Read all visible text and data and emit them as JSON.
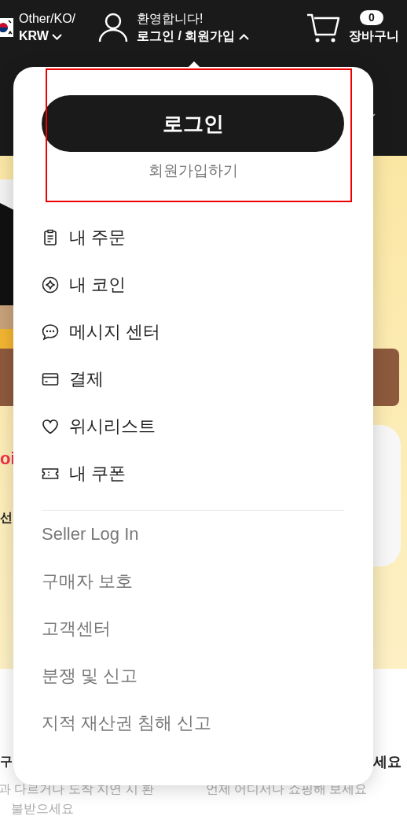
{
  "header": {
    "region": {
      "line1": "Other/KO/",
      "currency": "KRW"
    },
    "account": {
      "greeting": "환영합니다!",
      "label": "로그인 / 회원가입",
      "expanded": true
    },
    "cart": {
      "count": "0",
      "label": "장바구니"
    }
  },
  "account_menu": {
    "login_button": "로그인",
    "signup_link": "회원가입하기",
    "items": [
      {
        "label": "내 주문"
      },
      {
        "label": "내 코인"
      },
      {
        "label": "메시지 센터"
      },
      {
        "label": "결제"
      },
      {
        "label": "위시리스트"
      },
      {
        "label": "내 쿠폰"
      }
    ],
    "links": [
      "Seller Log In",
      "구매자 보호",
      "고객센터",
      "분쟁 및 신고",
      "지적 재산권 침해 신고"
    ]
  },
  "background": {
    "fragments": [
      {
        "text": "oi",
        "kind": "accent"
      },
      {
        "text": "선",
        "kind": "heading"
      },
      {
        "text": "구",
        "kind": "heading"
      },
      {
        "text": "세요",
        "kind": "heading"
      },
      {
        "text": "과 다르거나 도착 지연 시 환",
        "kind": "faded"
      },
      {
        "text": "불받으세요",
        "kind": "faded"
      },
      {
        "text": "언제 어디서나 쇼핑해 보세요",
        "kind": "faded"
      }
    ]
  }
}
